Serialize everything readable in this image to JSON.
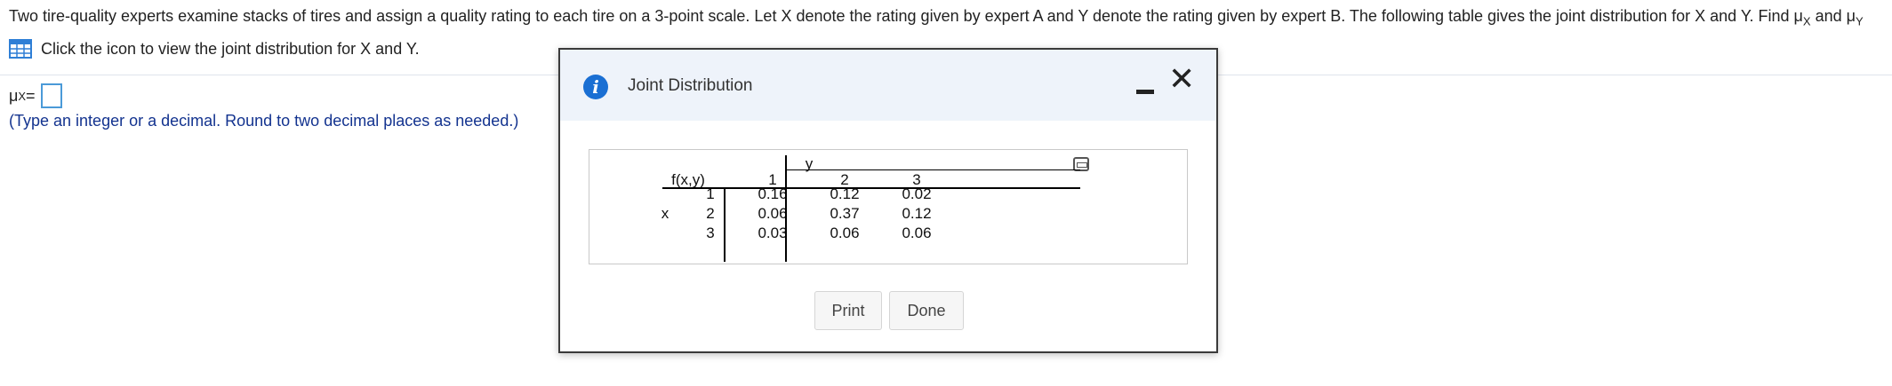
{
  "question": {
    "text": "Two tire-quality experts examine stacks of tires and assign a quality rating to each tire on a 3-point scale. Let X denote the rating given by expert A and Y denote the rating given by expert B. The following table gives the joint distribution for X and Y. Find μ",
    "sub_x": "X",
    "and": " and μ",
    "sub_y": "Y"
  },
  "link": {
    "label": "Click the icon to view the joint distribution for X and Y."
  },
  "answer": {
    "mu": "μ",
    "sub": "X",
    "equals": " =",
    "value": ""
  },
  "hint": "(Type an integer or a decimal. Round to two decimal places as needed.)",
  "dialog": {
    "title": "Joint Distribution",
    "print_label": "Print",
    "done_label": "Done",
    "table": {
      "corner_label": "f(x,y)",
      "col_var": "y",
      "row_var": "x",
      "col_headers": [
        "1",
        "2",
        "3"
      ],
      "row_headers": [
        "1",
        "2",
        "3"
      ],
      "rows": [
        [
          "0.16",
          "0.12",
          "0.02"
        ],
        [
          "0.06",
          "0.37",
          "0.12"
        ],
        [
          "0.03",
          "0.06",
          "0.06"
        ]
      ]
    }
  },
  "colors": {
    "accent": "#1a6fd3",
    "hint": "#13338f",
    "input_border": "#4a9ad8"
  }
}
